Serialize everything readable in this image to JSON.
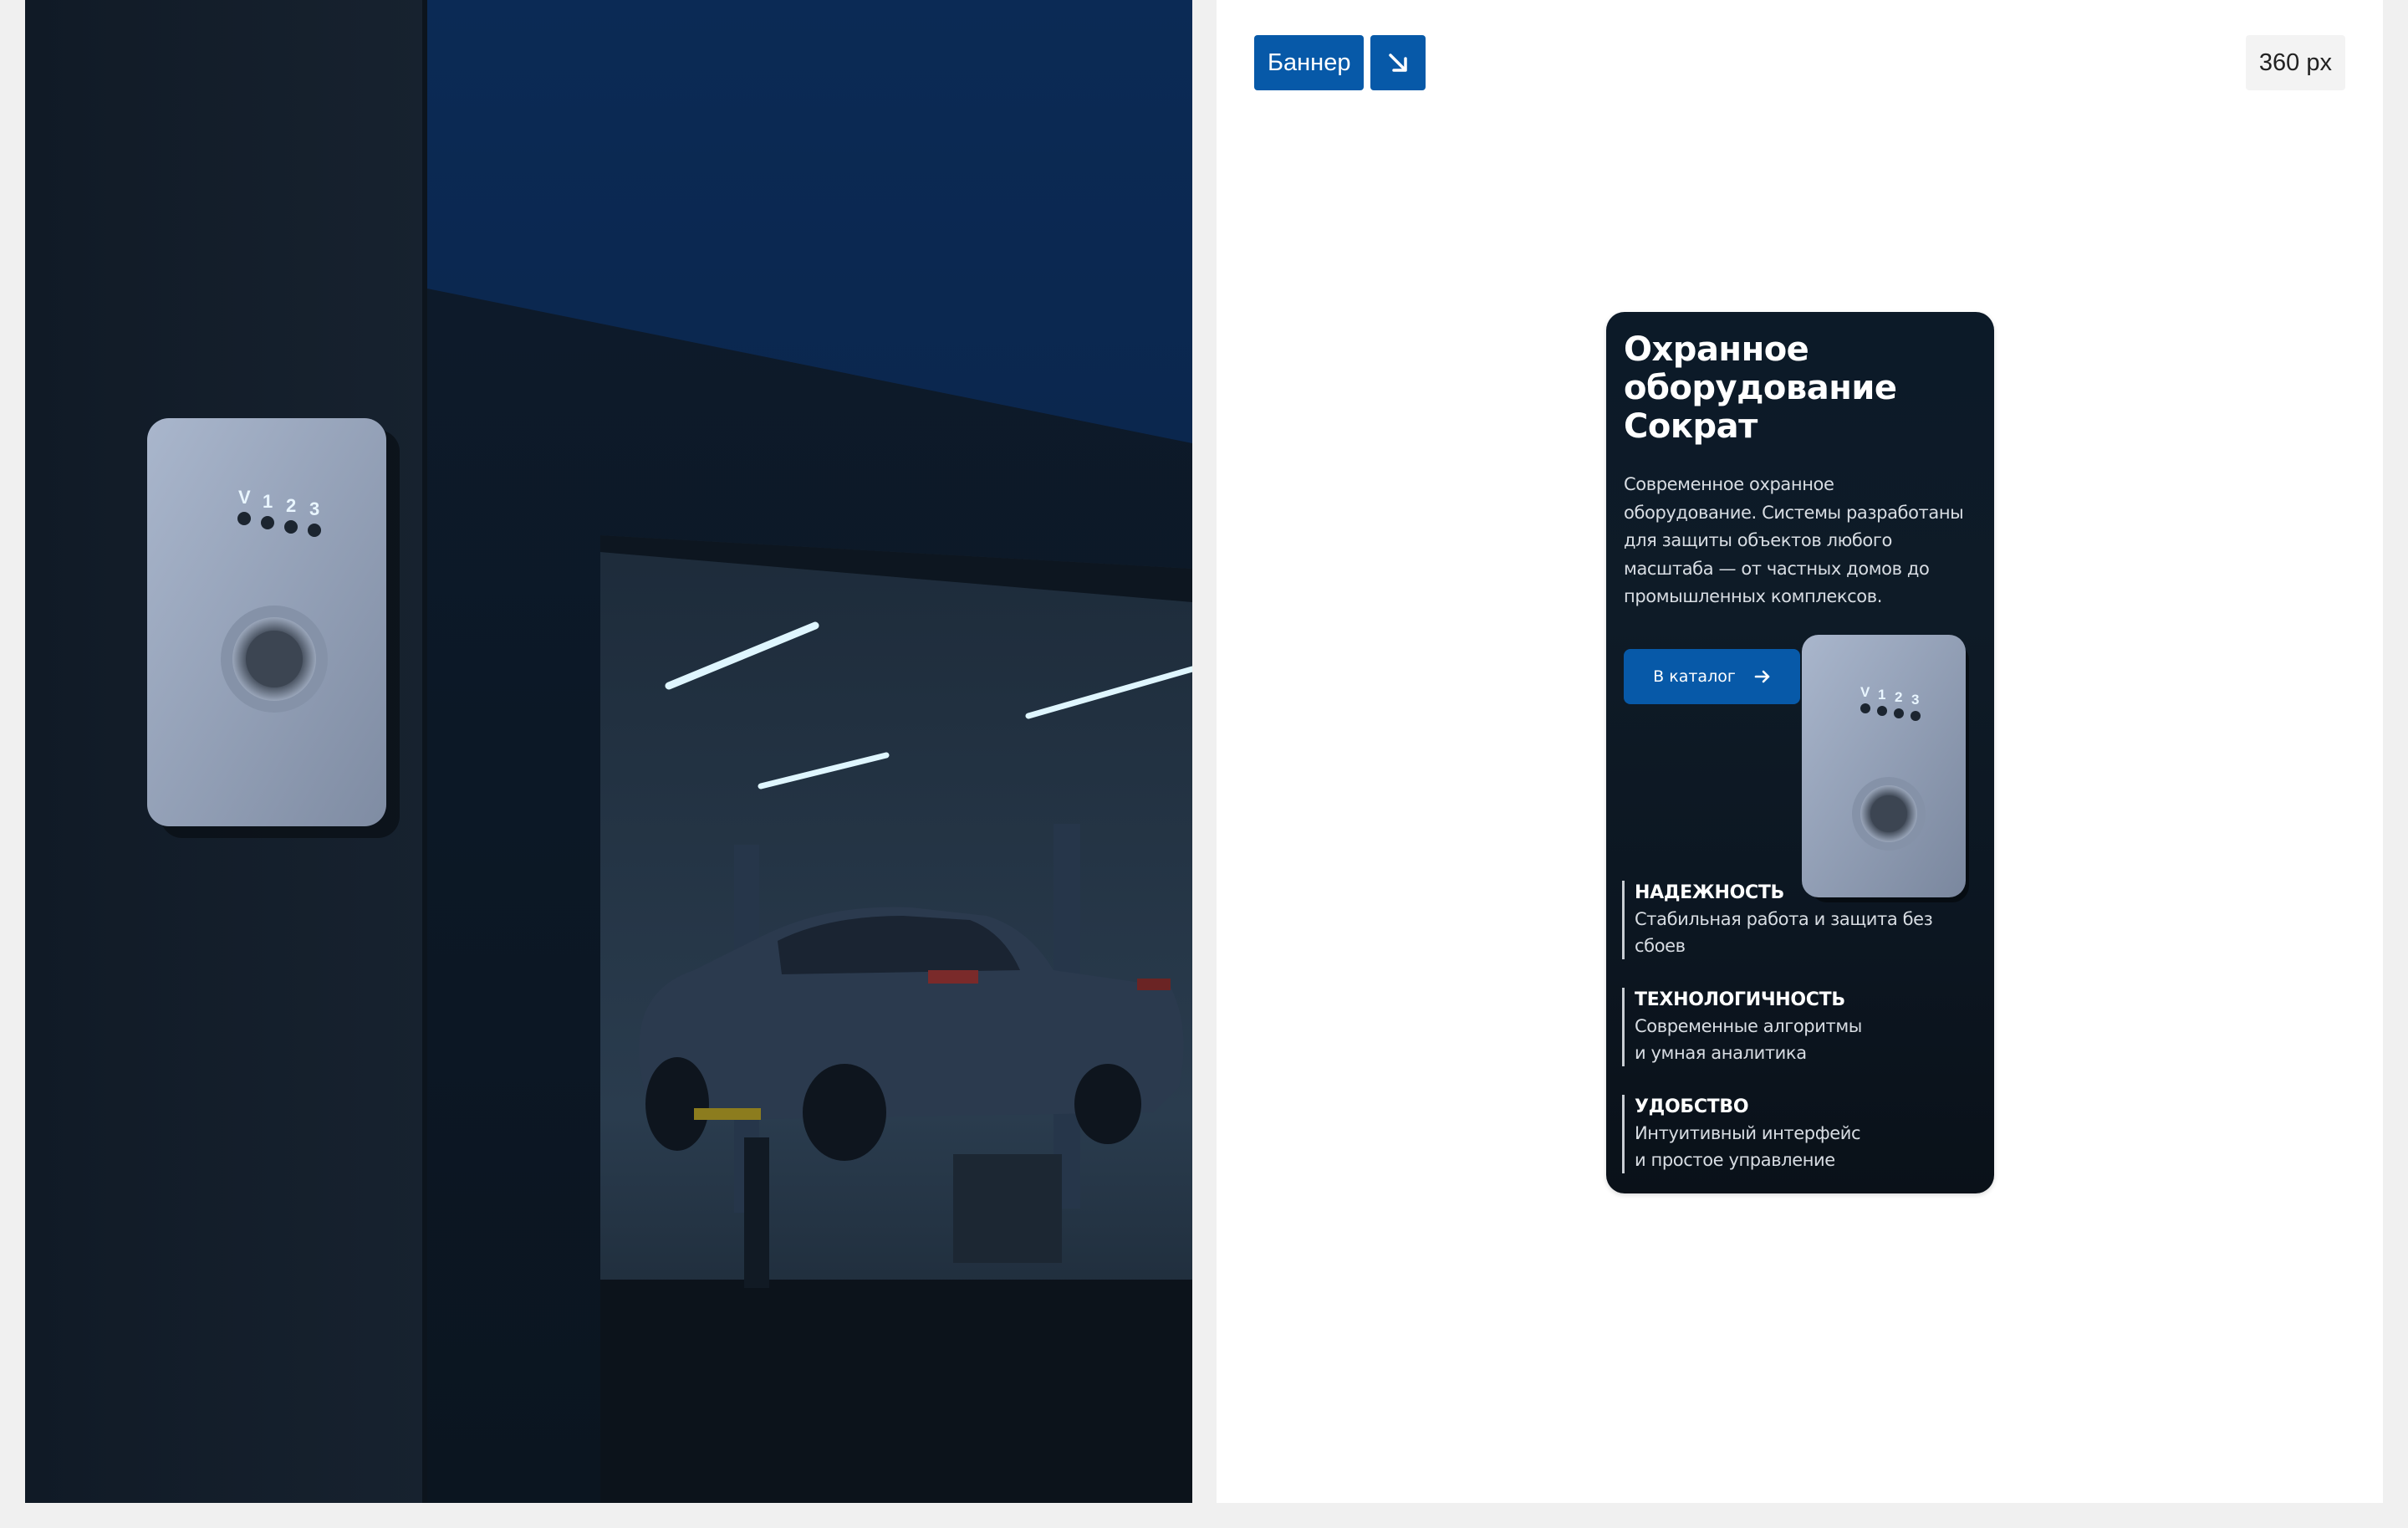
{
  "photo": {
    "keypad_labels": [
      "V",
      "1",
      "2",
      "3"
    ]
  },
  "toolbar": {
    "banner_label": "Баннер",
    "arrow_icon": "arrow-down-right-icon",
    "width_label": "360 px"
  },
  "banner": {
    "title_lines": [
      "Охранное",
      "оборудование",
      "Сократ"
    ],
    "description_lines": [
      "Современное охранное",
      "оборудование. Системы разработаны",
      "для защиты объектов любого",
      "масштаба — от частных домов до",
      "промышленных комплексов."
    ],
    "cta_label": "В каталог",
    "cta_icon": "arrow-right-icon",
    "device_keypad_labels": [
      "V",
      "1",
      "2",
      "3"
    ],
    "features": [
      {
        "title": "НАДЕЖНОСТЬ",
        "lines": [
          "Стабильная работа и защита без",
          "сбоев"
        ]
      },
      {
        "title": "ТЕХНОЛОГИЧНОСТЬ",
        "lines": [
          "Современные алгоритмы",
          "и умная аналитика"
        ]
      },
      {
        "title": "УДОБСТВО",
        "lines": [
          "Интуитивный интерфейс",
          "и простое управление"
        ]
      }
    ]
  },
  "colors": {
    "accent": "#0759a8",
    "card_bg": "#0c1a28",
    "page_bg": "#f0f0f0"
  }
}
